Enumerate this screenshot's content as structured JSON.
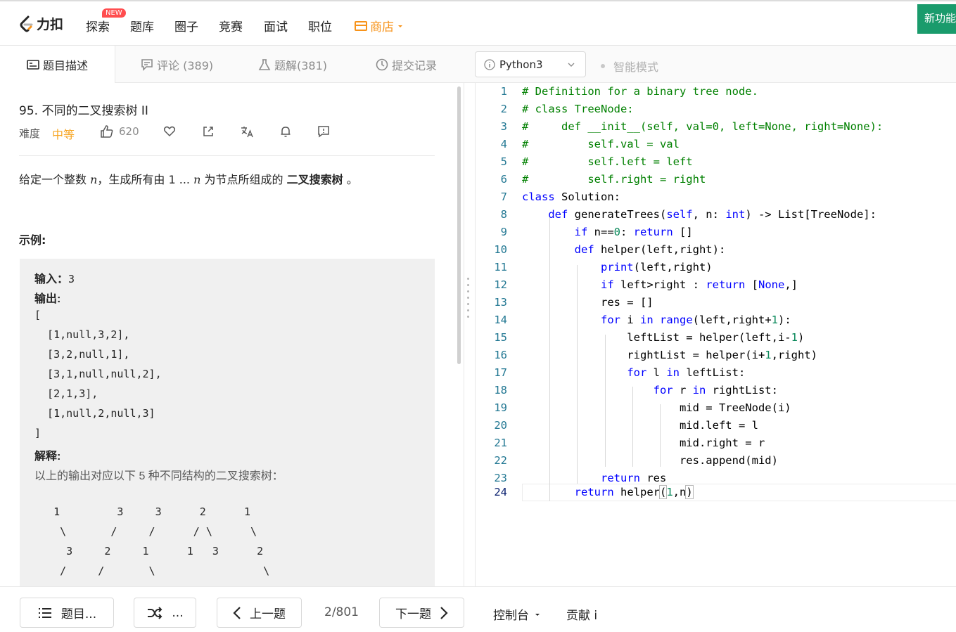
{
  "nav": {
    "logo_text": "力扣",
    "items": [
      "探索",
      "题库",
      "圈子",
      "竞赛",
      "面试",
      "职位"
    ],
    "new_badge": "NEW",
    "shop": "商店",
    "new_feature": "新功能"
  },
  "tabs": {
    "description": "题目描述",
    "comments": "评论 (389)",
    "solutions": "题解(381)",
    "submissions": "提交记录"
  },
  "editor_bar": {
    "language": "Python3",
    "smart_mode": "智能模式"
  },
  "problem": {
    "title": "95. 不同的二叉搜索树 II",
    "difficulty_label": "难度",
    "difficulty": "中等",
    "likes": "620",
    "desc_1": "给定一个整数 ",
    "desc_n1": "n",
    "desc_2": "，生成所有由 1 ... ",
    "desc_n2": "n",
    "desc_3": " 为节点所组成的 ",
    "desc_bold": "二叉搜索树",
    "desc_4": " 。",
    "example_label": "示例:",
    "example": {
      "input_label": "输入：",
      "input_value": "3",
      "output_label": "输出:",
      "output_lines": [
        "[",
        "  [1,null,3,2],",
        "  [3,2,null,1],",
        "  [3,1,null,null,2],",
        "  [2,1,3],",
        "  [1,null,2,null,3]",
        "]"
      ],
      "explain_label": "解释:",
      "explain_text": "以上的输出对应以下 5 种不同结构的二叉搜索树：",
      "tree_lines": [
        "   1         3     3      2      1",
        "    \\       /     /      / \\      \\",
        "     3     2     1      1   3      2",
        "    /     /       \\                 \\"
      ]
    }
  },
  "code_lines": [
    "# Definition for a binary tree node.",
    "# class TreeNode:",
    "#     def __init__(self, val=0, left=None, right=None):",
    "#         self.val = val",
    "#         self.left = left",
    "#         self.right = right",
    "class Solution:",
    "    def generateTrees(self, n: int) -> List[TreeNode]:",
    "        if n==0: return []",
    "        def helper(left,right):",
    "            print(left,right)",
    "            if left>right : return [None,]",
    "            res = []",
    "            for i in range(left,right+1):",
    "                leftList = helper(left,i-1)",
    "                rightList = helper(i+1,right)",
    "                for l in leftList:",
    "                    for r in rightList:",
    "                        mid = TreeNode(i)",
    "                        mid.left = l",
    "                        mid.right = r",
    "                        res.append(mid)",
    "            return res",
    "        return helper(1,n)"
  ],
  "bottom": {
    "problem_list": "题目...",
    "random": "...",
    "prev": "上一题",
    "page": "2/801",
    "next": "下一题",
    "console": "控制台",
    "contribute": "贡献 i"
  },
  "colors": {
    "accent": "#f7931a",
    "difficulty": "#f7a521",
    "new_feature_bg": "#1a9b6c",
    "code_keyword": "#0000ff",
    "code_comment": "#008000",
    "code_number": "#09885a",
    "line_number": "#237893"
  }
}
